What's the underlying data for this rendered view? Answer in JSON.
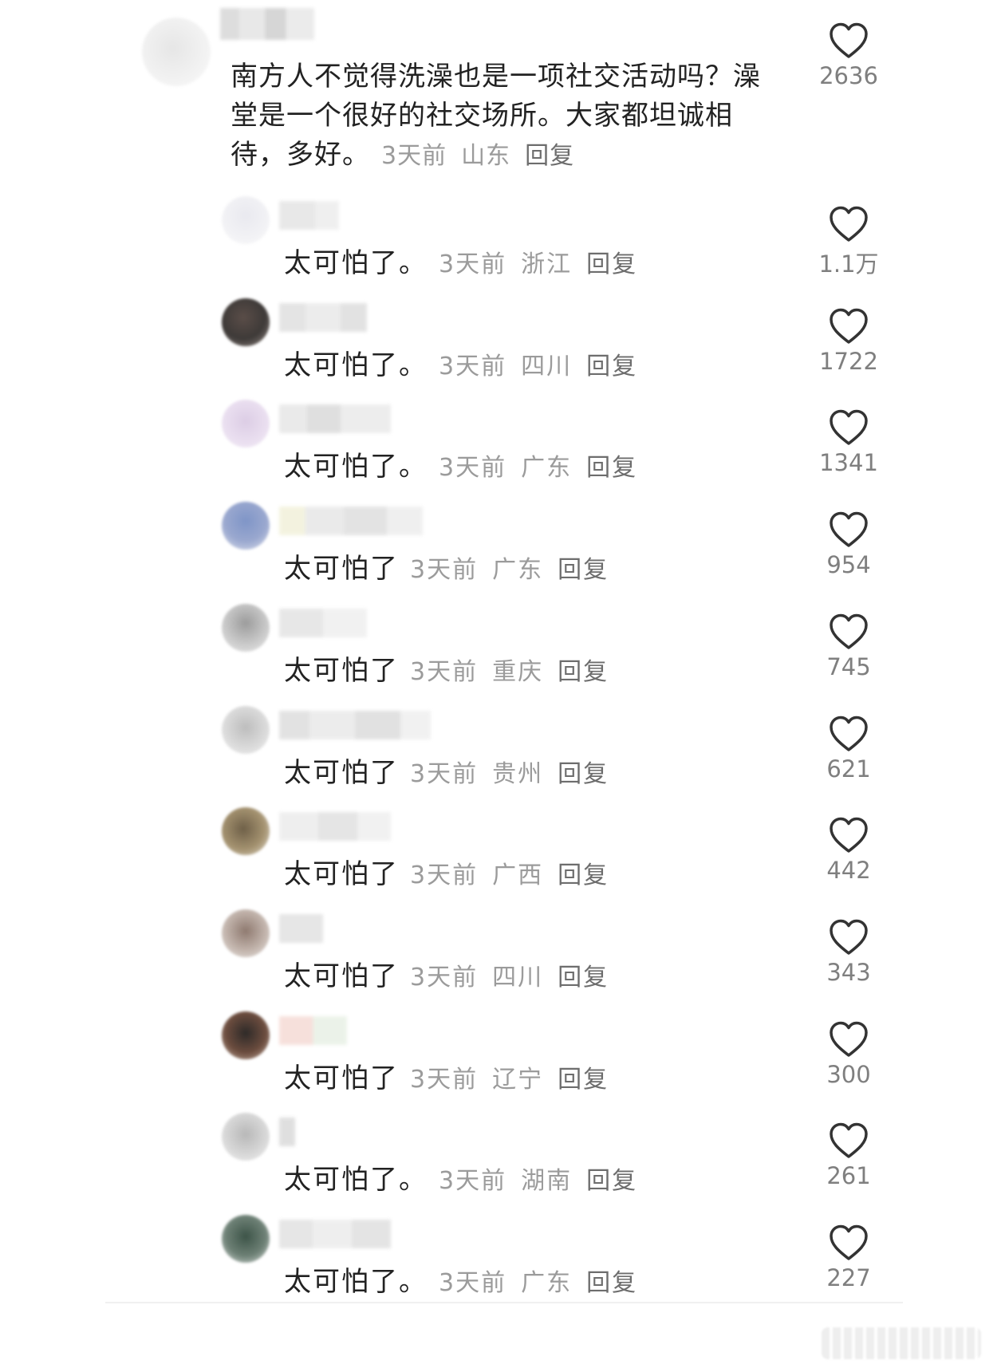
{
  "top_comment": {
    "text": "南方人不觉得洗澡也是一项社交活动吗？澡堂是一个很好的社交场所。大家都坦诚相待，多好。",
    "time": "3天前",
    "location": "山东",
    "reply_label": "回复",
    "likes": "2636"
  },
  "replies": [
    {
      "text": "太可怕了。",
      "time": "3天前",
      "location": "浙江",
      "reply_label": "回复",
      "likes": "1.1万"
    },
    {
      "text": "太可怕了。",
      "time": "3天前",
      "location": "四川",
      "reply_label": "回复",
      "likes": "1722"
    },
    {
      "text": "太可怕了。",
      "time": "3天前",
      "location": "广东",
      "reply_label": "回复",
      "likes": "1341"
    },
    {
      "text": "太可怕了",
      "time": "3天前",
      "location": "广东",
      "reply_label": "回复",
      "likes": "954"
    },
    {
      "text": "太可怕了",
      "time": "3天前",
      "location": "重庆",
      "reply_label": "回复",
      "likes": "745"
    },
    {
      "text": "太可怕了",
      "time": "3天前",
      "location": "贵州",
      "reply_label": "回复",
      "likes": "621"
    },
    {
      "text": "太可怕了",
      "time": "3天前",
      "location": "广西",
      "reply_label": "回复",
      "likes": "442"
    },
    {
      "text": "太可怕了",
      "time": "3天前",
      "location": "四川",
      "reply_label": "回复",
      "likes": "343"
    },
    {
      "text": "太可怕了",
      "time": "3天前",
      "location": "辽宁",
      "reply_label": "回复",
      "likes": "300"
    },
    {
      "text": "太可怕了。",
      "time": "3天前",
      "location": "湖南",
      "reply_label": "回复",
      "likes": "261"
    },
    {
      "text": "太可怕了。",
      "time": "3天前",
      "location": "广东",
      "reply_label": "回复",
      "likes": "227"
    }
  ],
  "colors": {
    "text": "#222222",
    "meta": "#9b9b9b",
    "like_count": "#7f7f7f",
    "heart_stroke": "#333333"
  },
  "icons": {
    "like": "heart-outline-icon"
  }
}
